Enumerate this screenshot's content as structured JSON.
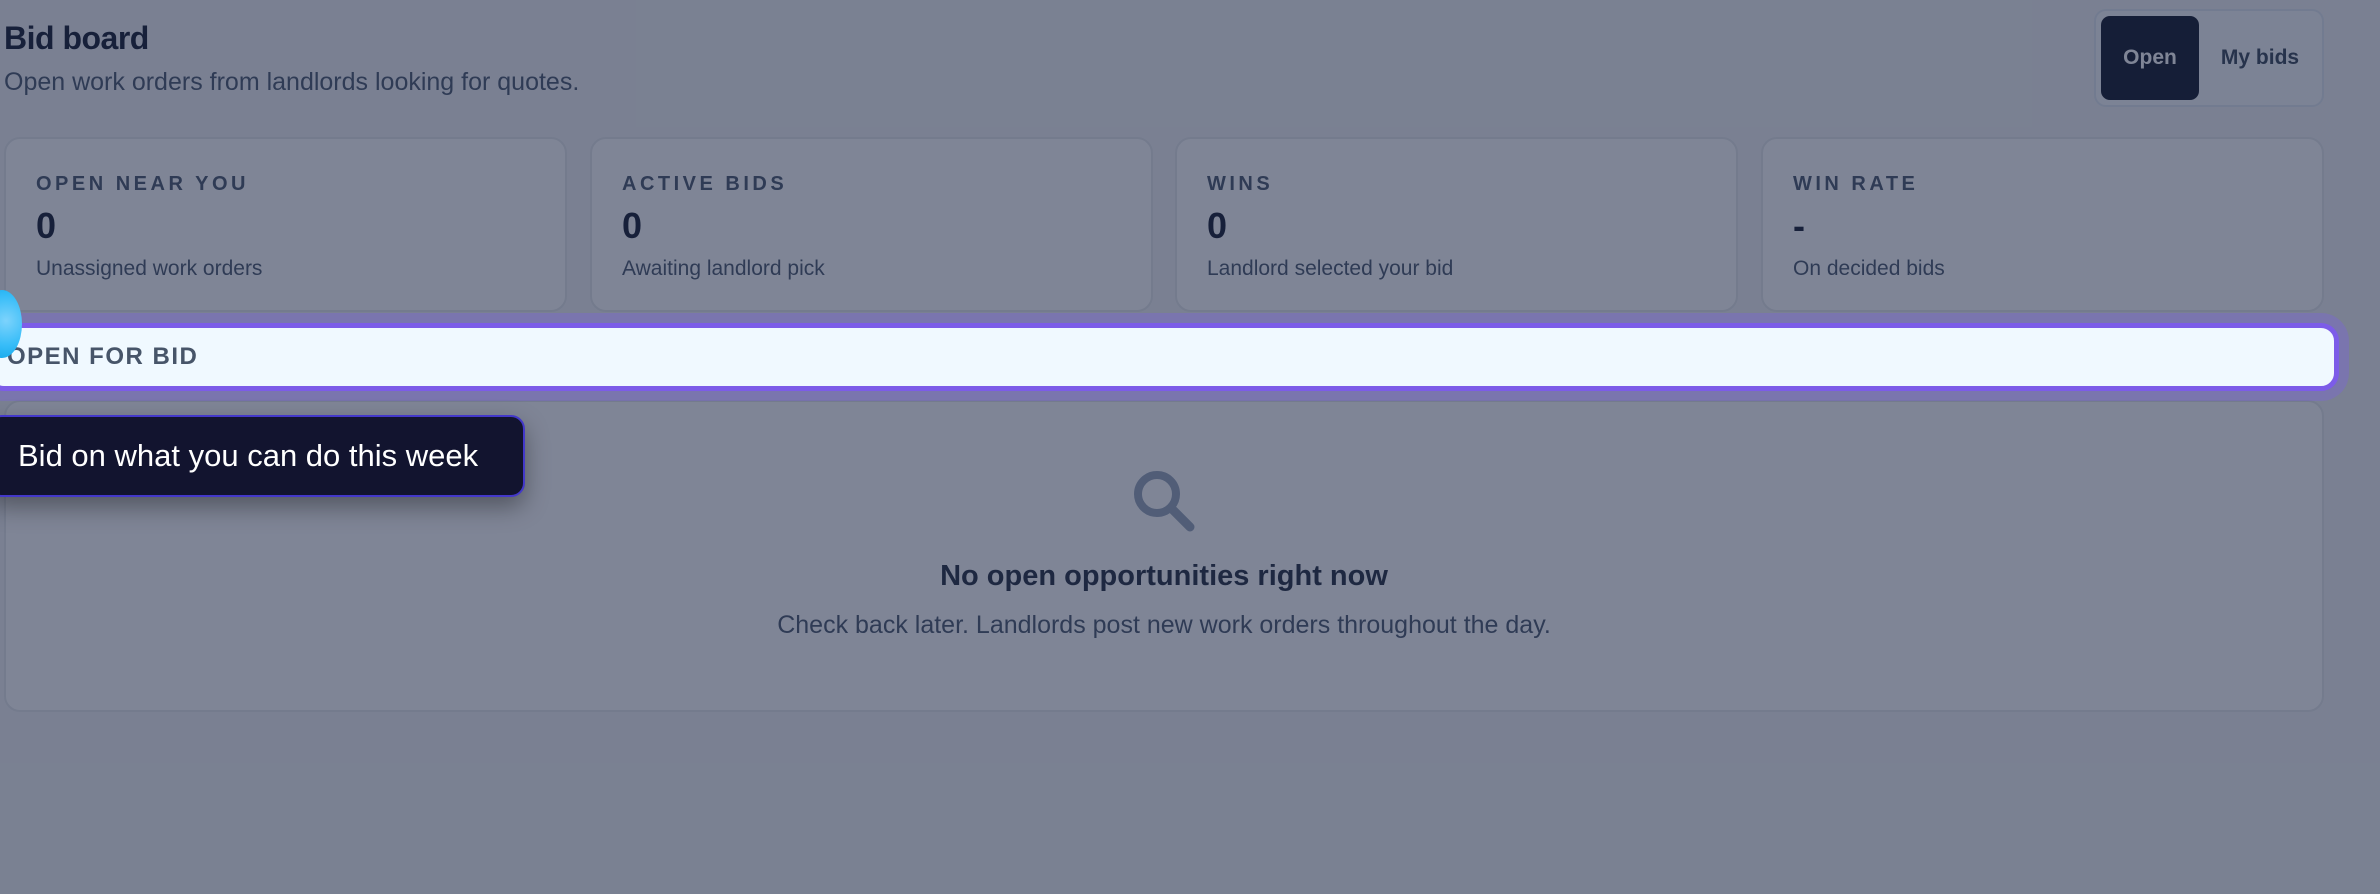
{
  "header": {
    "title": "Bid board",
    "subtitle": "Open work orders from landlords looking for quotes."
  },
  "view_toggle": {
    "options": [
      {
        "label": "Open",
        "active": true
      },
      {
        "label": "My bids",
        "active": false
      }
    ]
  },
  "stats": [
    {
      "label": "OPEN NEAR YOU",
      "value": "0",
      "desc": "Unassigned work orders"
    },
    {
      "label": "ACTIVE BIDS",
      "value": "0",
      "desc": "Awaiting landlord pick"
    },
    {
      "label": "WINS",
      "value": "0",
      "desc": "Landlord selected your bid"
    },
    {
      "label": "WIN RATE",
      "value": "-",
      "desc": "On decided bids"
    }
  ],
  "section": {
    "title": "OPEN FOR BID"
  },
  "empty_state": {
    "icon": "search-icon",
    "title": "No open opportunities right now",
    "description": "Check back later. Landlords post new work orders throughout the day."
  },
  "tour": {
    "tooltip_text": "Bid on what you can do this week"
  },
  "colors": {
    "accent": "#7c5ce8",
    "toggle_active_bg": "#0b1224",
    "tooltip_bg": "#12142f",
    "overlay": "#1e2946"
  }
}
